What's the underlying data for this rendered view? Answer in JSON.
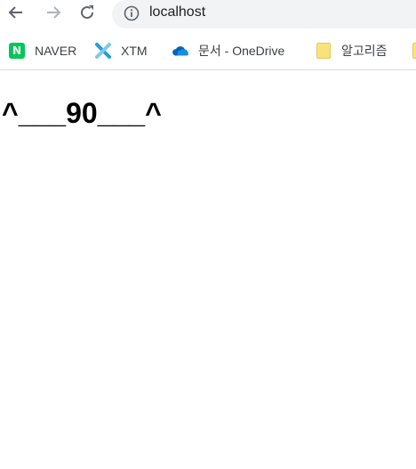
{
  "browser": {
    "url": "localhost"
  },
  "bookmarks": [
    {
      "label": "NAVER",
      "icon": "naver-icon"
    },
    {
      "label": "XTM",
      "icon": "xtm-icon"
    },
    {
      "label": "문서 - OneDrive",
      "icon": "onedrive-icon"
    },
    {
      "label": "알고리즘",
      "icon": "folder-icon"
    },
    {
      "label": "",
      "icon": "folder-icon"
    }
  ],
  "page": {
    "heading": "^___90___^"
  },
  "colors": {
    "naver": "#03c75a",
    "xtm": "#1aa3d9",
    "onedrive": "#0364b8",
    "folder": "#f9e27c",
    "omnibox": "#f1f3f4"
  }
}
